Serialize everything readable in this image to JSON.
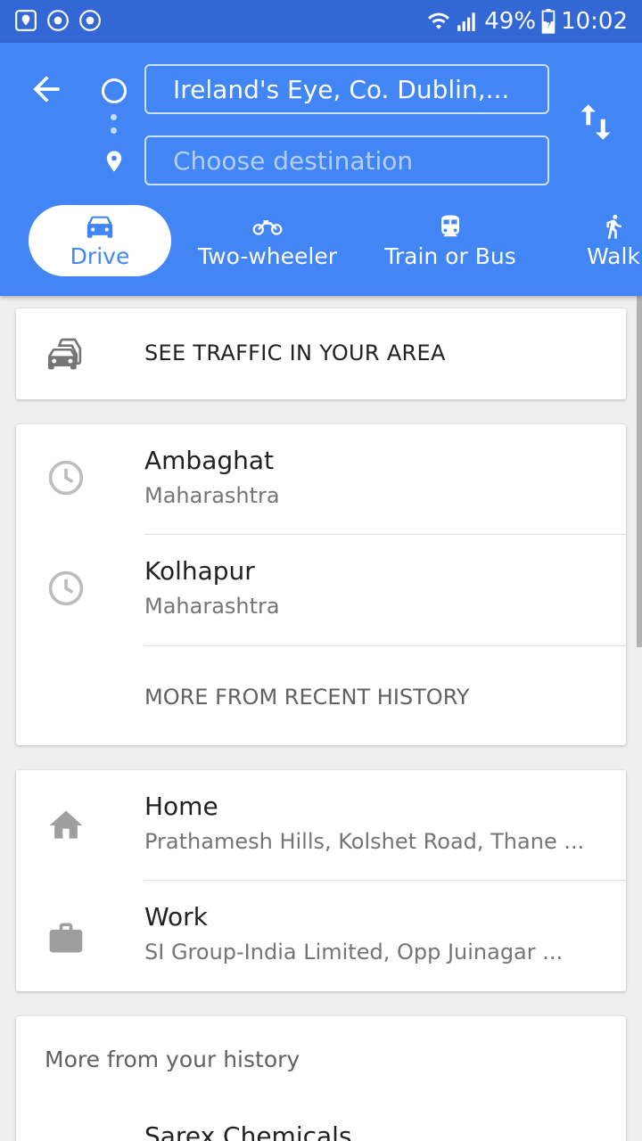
{
  "status_bar": {
    "battery": "49%",
    "time": "10:02"
  },
  "directions": {
    "origin_value": "Ireland's Eye, Co. Dublin,...",
    "destination_placeholder": "Choose destination"
  },
  "modes": [
    {
      "label": "Drive",
      "icon": "car-icon",
      "active": true
    },
    {
      "label": "Two-wheeler",
      "icon": "motorcycle-icon",
      "active": false
    },
    {
      "label": "Train or Bus",
      "icon": "train-icon",
      "active": false
    },
    {
      "label": "Walk",
      "icon": "walk-icon",
      "active": false
    }
  ],
  "traffic": {
    "label": "SEE TRAFFIC IN YOUR AREA",
    "icon": "traffic-icon"
  },
  "recent": {
    "items": [
      {
        "title": "Ambaghat",
        "subtitle": "Maharashtra",
        "icon": "clock-icon"
      },
      {
        "title": "Kolhapur",
        "subtitle": "Maharashtra",
        "icon": "clock-icon"
      }
    ],
    "more_label": "MORE FROM RECENT HISTORY"
  },
  "places": {
    "home": {
      "title": "Home",
      "subtitle": "Prathamesh Hills, Kolshet Road, Thane ...",
      "icon": "home-icon"
    },
    "work": {
      "title": "Work",
      "subtitle": "SI Group-India Limited, Opp Juinagar ...",
      "icon": "briefcase-icon"
    }
  },
  "history": {
    "header": "More from your history",
    "first_item": "Sarex Chemicals"
  },
  "colors": {
    "status_bar": "#3367d6",
    "header": "#4285f4",
    "background": "#eeeeee"
  }
}
